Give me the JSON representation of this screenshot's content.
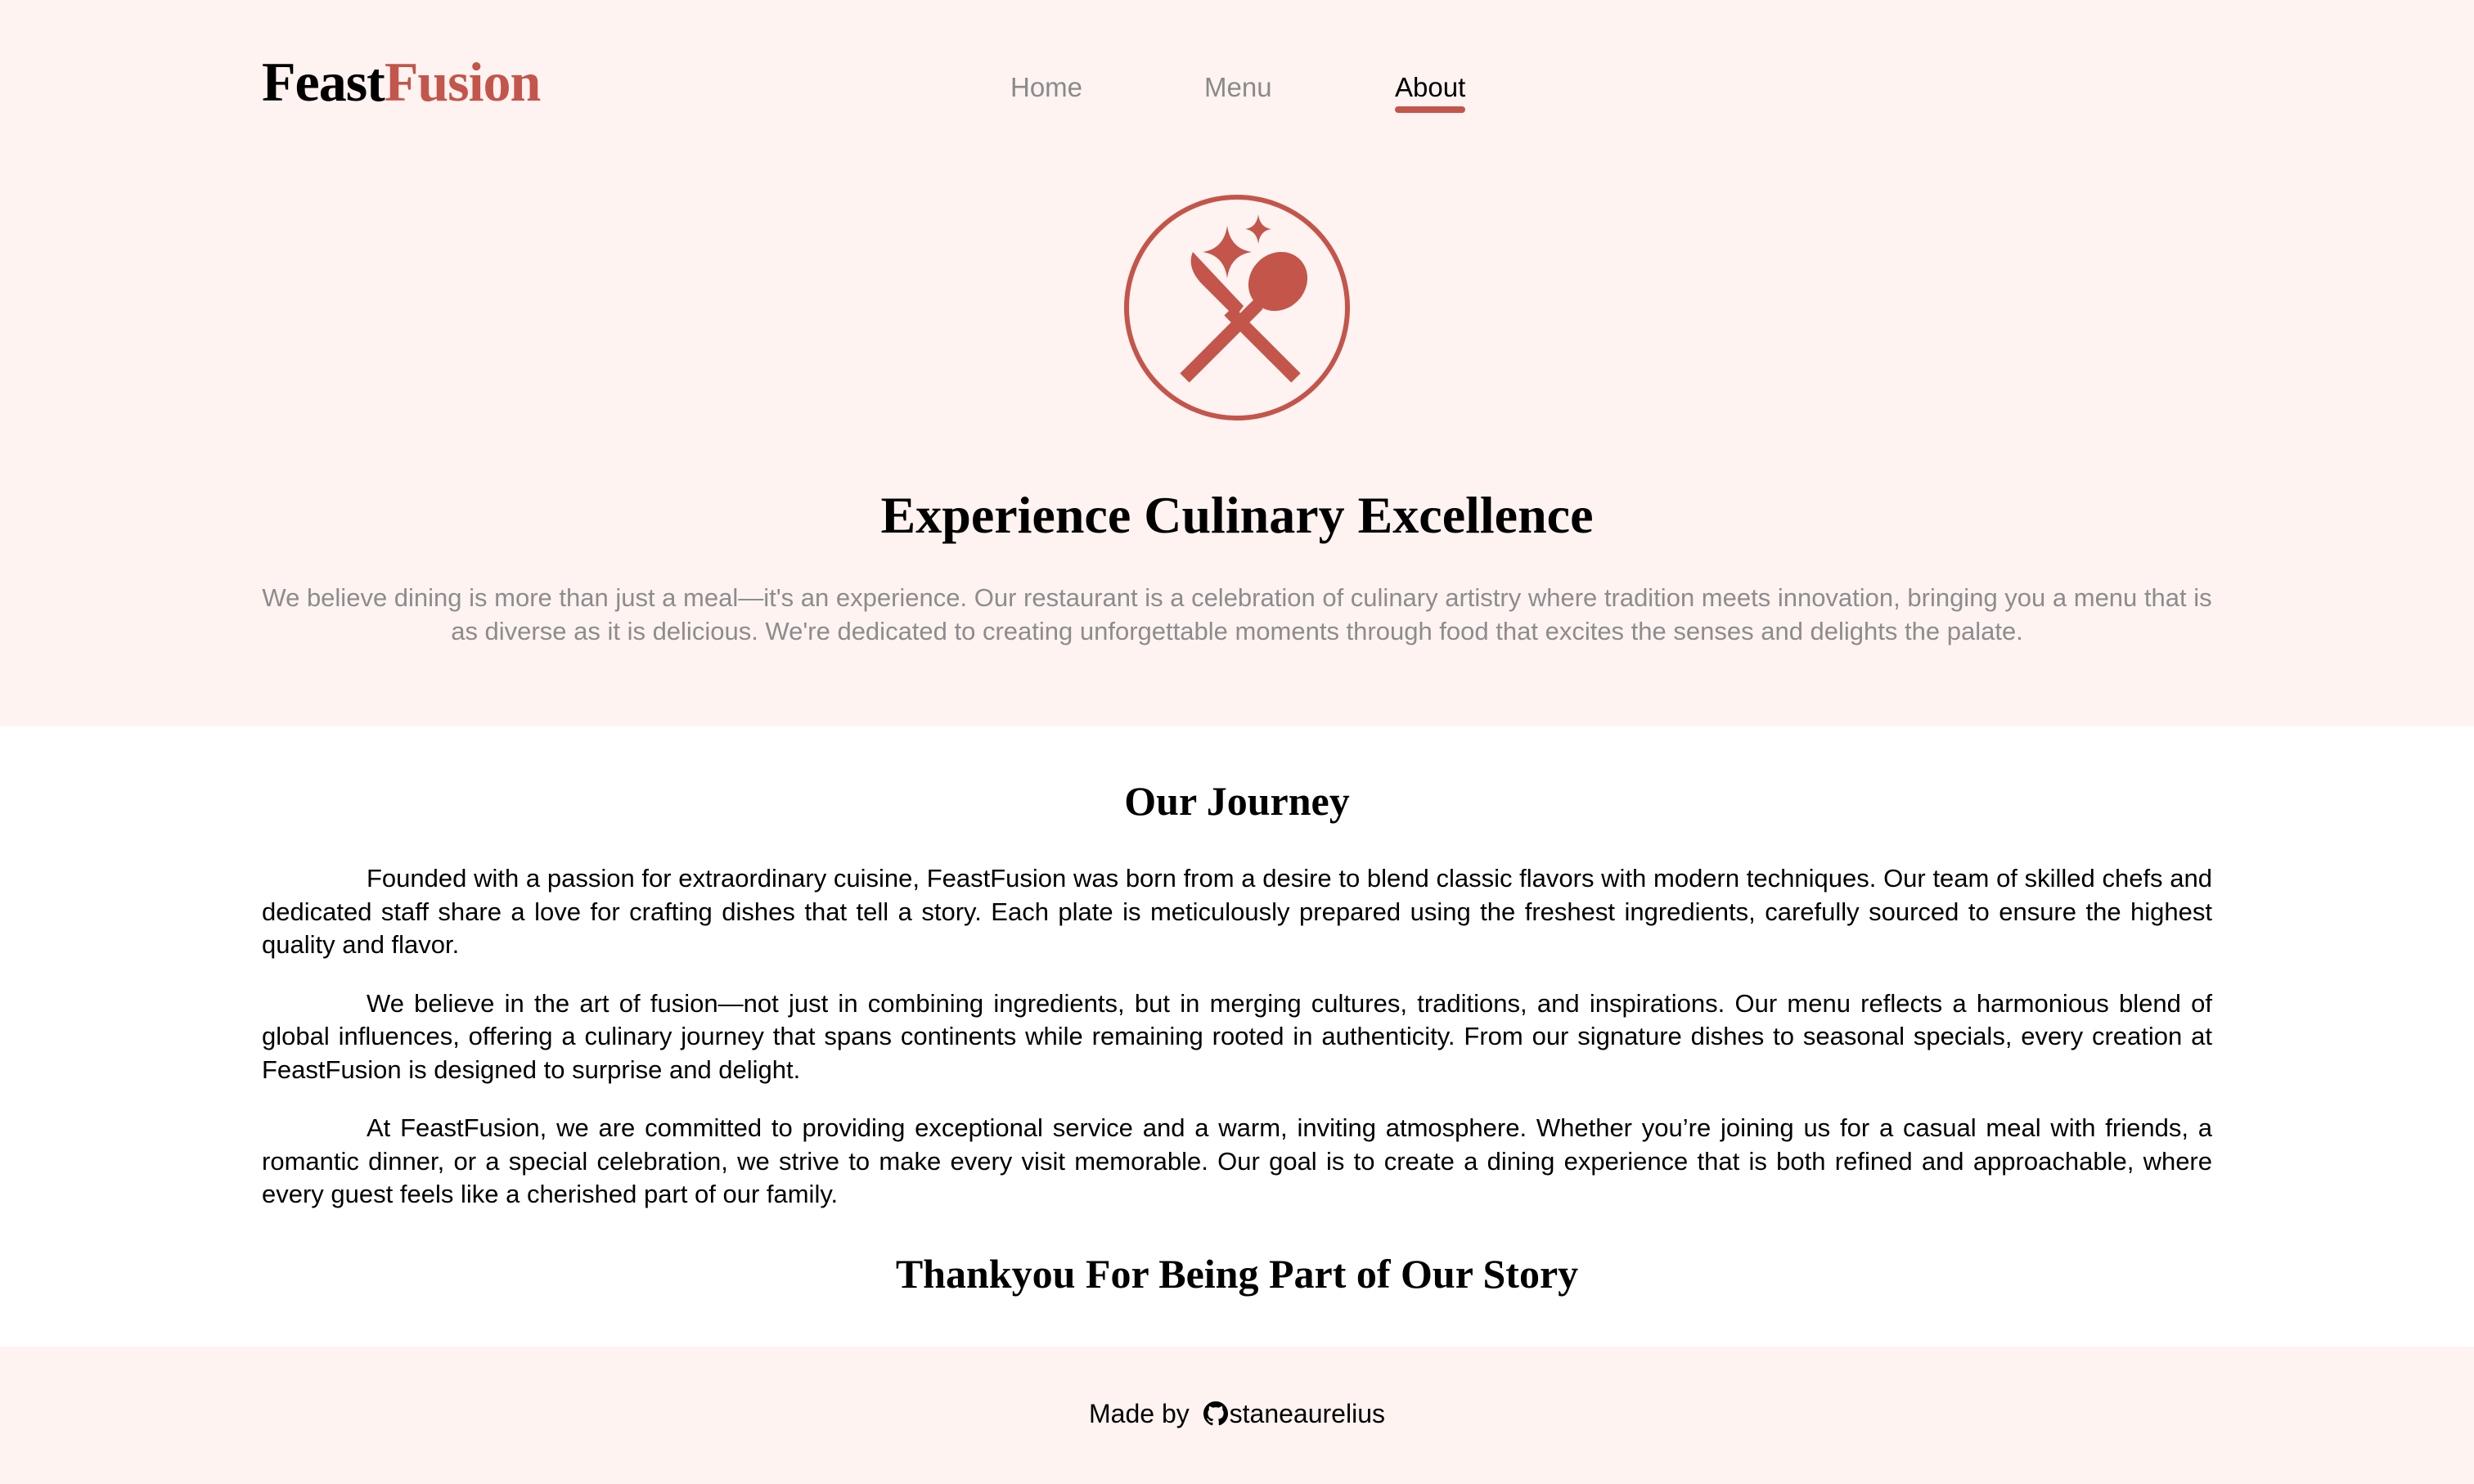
{
  "brand": {
    "part1": "Feast",
    "part2": "Fusion",
    "accent_color": "#c4554b"
  },
  "nav": {
    "items": [
      {
        "label": "Home",
        "active": false
      },
      {
        "label": "Menu",
        "active": false
      },
      {
        "label": "About",
        "active": true
      }
    ]
  },
  "hero": {
    "emblem_icon": "crossed-spoon-knife-sparkle-icon",
    "title": "Experience Culinary Excellence",
    "description": "We believe dining is more than just a meal—it's an experience. Our restaurant is a celebration of culinary artistry where tradition meets innovation, bringing you a menu that is as diverse as it is delicious. We're dedicated to creating unforgettable moments through food that excites the senses and delights the palate.",
    "background_color": "#fef3f1"
  },
  "journey": {
    "title": "Our Journey",
    "paragraphs": [
      "Founded with a passion for extraordinary cuisine, FeastFusion was born from a desire to blend classic flavors with modern techniques. Our team of skilled chefs and dedicated staff share a love for crafting dishes that tell a story. Each plate is meticulously prepared using the freshest ingredients, carefully sourced to ensure the highest quality and flavor.",
      "We believe in the art of fusion—not just in combining ingredients, but in merging cultures, traditions, and inspirations. Our menu reflects a harmonious blend of global influences, offering a culinary journey that spans continents while remaining rooted in authenticity. From our signature dishes to seasonal specials, every creation at FeastFusion is designed to surprise and delight.",
      "At FeastFusion, we are committed to providing exceptional service and a warm, inviting atmosphere. Whether you’re joining us for a casual meal with friends, a romantic dinner, or a special celebration, we strive to make every visit memorable. Our goal is to create a dining experience that is both refined and approachable, where every guest feels like a cherished part of our family."
    ],
    "closing": "Thankyou For Being Part of Our Story"
  },
  "footer": {
    "prefix": "Made by",
    "icon": "github-icon",
    "username": "staneaurelius"
  }
}
